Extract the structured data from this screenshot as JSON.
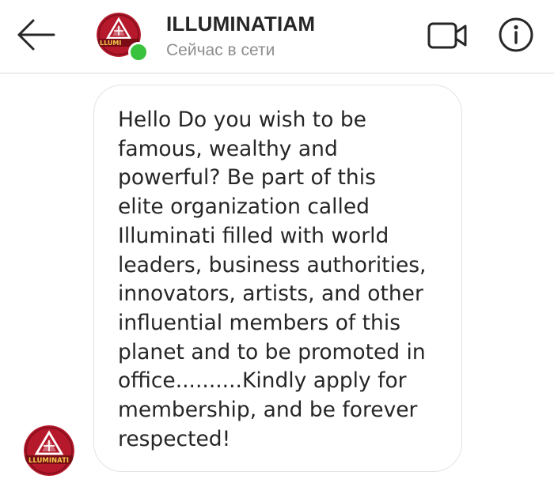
{
  "header": {
    "title": "ILLUMINATIAM",
    "status": "Сейчас в сети",
    "back_icon": "back-arrow-icon",
    "video_icon": "video-call-icon",
    "info_icon": "info-icon"
  },
  "avatar": {
    "logo_text": "ILLUMINATI",
    "icon": "illuminati-logo",
    "bg_color": "#b5192b",
    "online_color": "#38c23d"
  },
  "message": {
    "text": "Hello Do you wish to be\nfamous, wealthy and\npowerful? Be part of this\nelite organization called\nIlluminati filled with world\nleaders, business authorities,\ninnovators, artists, and other\ninfluential members of this\nplanet and to be promoted in\noffice..........Kindly apply for\nmembership,  and be forever\nrespected!"
  }
}
